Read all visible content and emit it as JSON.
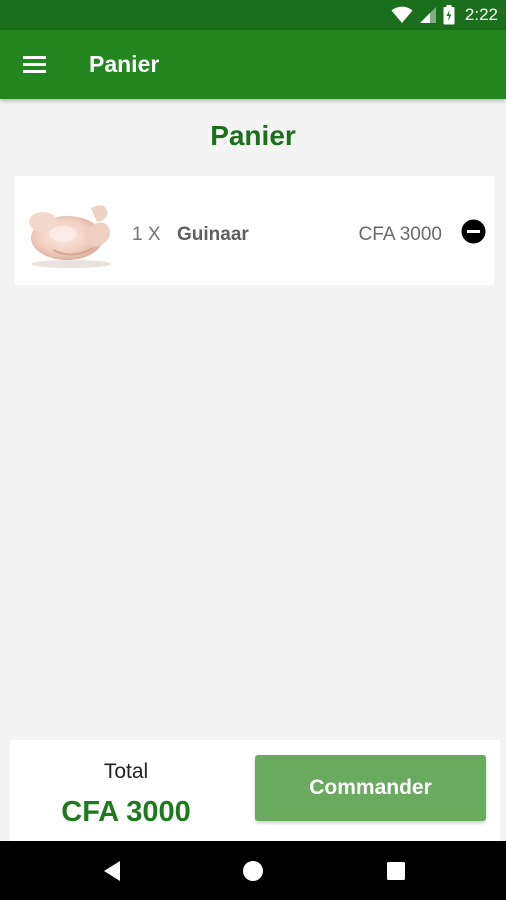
{
  "status_bar": {
    "time": "2:22",
    "icons": [
      "wifi-icon",
      "cellular-signal-icon",
      "battery-icon"
    ]
  },
  "app_bar": {
    "title": "Panier",
    "menu_icon": "hamburger-menu-icon"
  },
  "page": {
    "heading": "Panier"
  },
  "cart": {
    "items": [
      {
        "quantity": "1 X",
        "name": "Guinaar",
        "price": "CFA 3000",
        "image": "chicken-image",
        "remove_icon": "minus-circle-icon"
      }
    ]
  },
  "footer": {
    "total_label": "Total",
    "total_value": "CFA 3000",
    "order_button_label": "Commander"
  },
  "nav_bar": {
    "icons": [
      "back-triangle-icon",
      "home-circle-icon",
      "recents-square-icon"
    ]
  },
  "colors": {
    "status_bar": "#1b6e1b",
    "app_bar": "#23861f",
    "heading_green": "#1d6e1d",
    "total_green": "#1f7a1f",
    "order_button": "#6aaa5f",
    "background": "#f4f4f4"
  }
}
